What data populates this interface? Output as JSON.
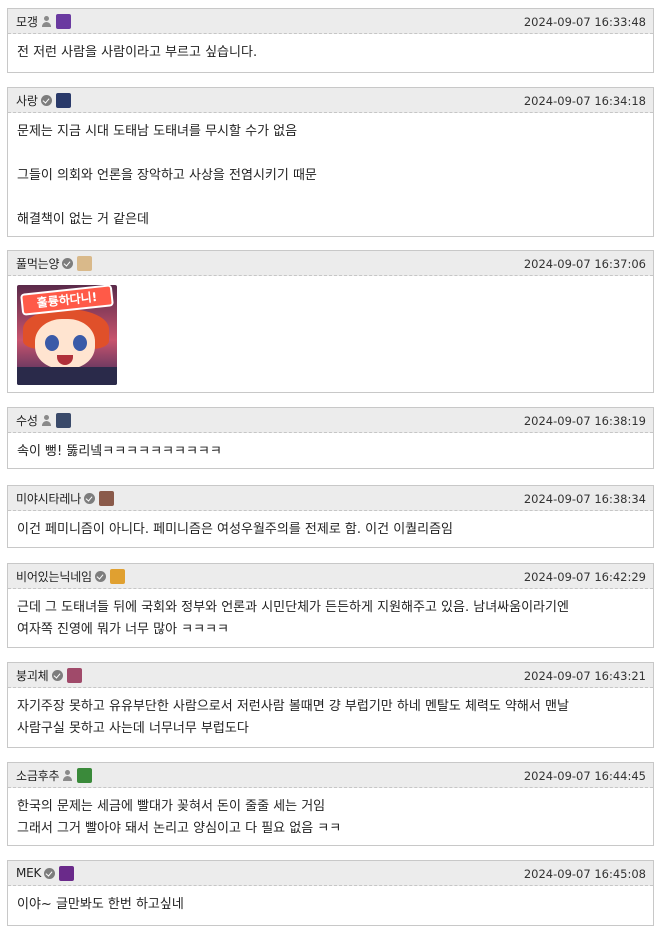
{
  "comments": [
    {
      "nick": "모갱",
      "badge": "person",
      "level_color": "#6a3aa0",
      "date": "2024-09-07 16:33:48",
      "lines": [
        "전 저런 사람을 사람이라고 부르고 싶습니다."
      ]
    },
    {
      "nick": "사랑",
      "badge": "check",
      "level_color": "#2a3a6a",
      "date": "2024-09-07 16:34:18",
      "lines": [
        "문제는 지금 시대 도태남 도태녀를 무시할 수가 없음",
        "",
        "그들이 의회와 언론을 장악하고 사상을 전염시키기 때문",
        "",
        "해결책이 없는 거 같은데"
      ]
    },
    {
      "nick": "풀먹는양",
      "badge": "check",
      "level_color": "#d9b98a",
      "date": "2024-09-07 16:37:06",
      "sticker_text": "훌륭하다니!",
      "lines": []
    },
    {
      "nick": "수성",
      "badge": "person",
      "level_color": "#3a4a6a",
      "date": "2024-09-07 16:38:19",
      "lines": [
        "속이 뻥! 뚫리넼ㅋㅋㅋㅋㅋㅋㅋㅋㅋㅋ"
      ]
    },
    {
      "nick": "미야시타레나",
      "badge": "check",
      "level_color": "#8a5a4a",
      "date": "2024-09-07 16:38:34",
      "lines": [
        "이건 페미니즘이 아니다. 페미니즘은 여성우월주의를 전제로 함. 이건 이퀄리즘임"
      ]
    },
    {
      "nick": "비어있는닉네임",
      "badge": "check",
      "level_color": "#e0a030",
      "date": "2024-09-07 16:42:29",
      "lines": [
        "근데 그 도태녀들 뒤에 국회와 정부와 언론과 시민단체가 든든하게 지원해주고 있음.  남녀싸움이라기엔",
        "여자쪽 진영에 뭐가 너무 많아 ㅋㅋㅋㅋ"
      ]
    },
    {
      "nick": "붕괴체",
      "badge": "check",
      "level_color": "#a04a6a",
      "date": "2024-09-07 16:43:21",
      "lines": [
        "자기주장 못하고 유유부단한 사람으로서 저런사람 볼때면 걍 부럽기만 하네 멘탈도 체력도 약해서 맨날",
        "사람구실 못하고 사는데 너무너무 부럽도다"
      ]
    },
    {
      "nick": "소금후추",
      "badge": "person",
      "level_color": "#3a8a3a",
      "date": "2024-09-07 16:44:45",
      "lines": [
        "한국의 문제는 세금에 빨대가 꽂혀서 돈이 줄줄 세는 거임",
        "그래서 그거 빨아야 돼서 논리고 양심이고 다 필요 없음 ㅋㅋ"
      ]
    },
    {
      "nick": "MEK",
      "badge": "check",
      "level_color": "#6a2a8a",
      "date": "2024-09-07 16:45:08",
      "lines": [
        "이야~ 글만봐도 한번 하고싶네"
      ]
    }
  ]
}
